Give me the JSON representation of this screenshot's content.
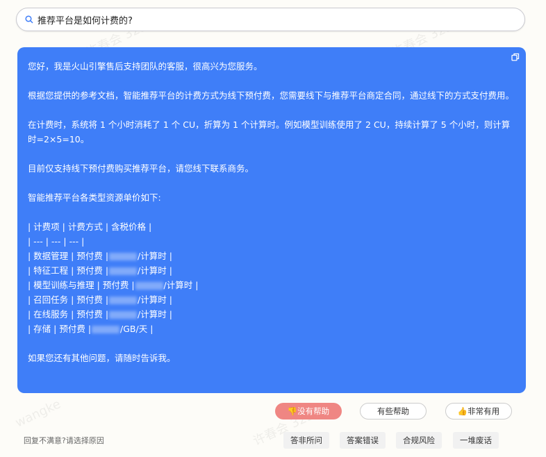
{
  "search": {
    "query": "推荐平台是如何计费的?"
  },
  "answer": {
    "greeting": "您好，我是火山引擎售后支持团队的客服，很高兴为您服务。",
    "para1": "根据您提供的参考文档，智能推荐平台的计费方式为线下预付费，您需要线下与推荐平台商定合同，通过线下的方式支付费用。",
    "para2": "在计费时，系统将 1 个小时消耗了 1 个 CU，折算为 1 个计算时。例如模型训练使用了 2 CU，持续计算了 5 个小时，则计算时=2×5=10。",
    "para3": "目前仅支持线下预付费购买推荐平台，请您线下联系商务。",
    "para4": "智能推荐平台各类型资源单价如下:",
    "table_header": "| 计费项 | 计费方式 | 含税价格 |",
    "table_sep": "| --- | --- | --- |",
    "rows": [
      {
        "pre": "| 数据管理 | 预付费 |",
        "post": "/计算时 |"
      },
      {
        "pre": "| 特征工程 | 预付费 |",
        "post": "/计算时 |"
      },
      {
        "pre": "| 模型训练与推理 | 预付费 |",
        "post": "/计算时 |"
      },
      {
        "pre": "| 召回任务 | 预付费 |",
        "post": "/计算时 |"
      },
      {
        "pre": "| 在线服务 | 预付费 |",
        "post": "/计算时 |"
      },
      {
        "pre": "| 存储 | 预付费 |",
        "post": "/GB/天 |"
      }
    ],
    "closing": "如果您还有其他问题，请随时告诉我。"
  },
  "feedback": {
    "not_helpful": "没有帮助",
    "somewhat": "有些帮助",
    "very": "非常有用"
  },
  "reasons": {
    "label": "回复不满意?请选择原因",
    "items": [
      "答非所问",
      "答案错误",
      "合规风险",
      "一堆废话"
    ]
  },
  "watermarks": [
    "许春会 3239",
    "wangke"
  ],
  "colors": {
    "card": "#3f7ef8",
    "negative": "#ef8683"
  }
}
